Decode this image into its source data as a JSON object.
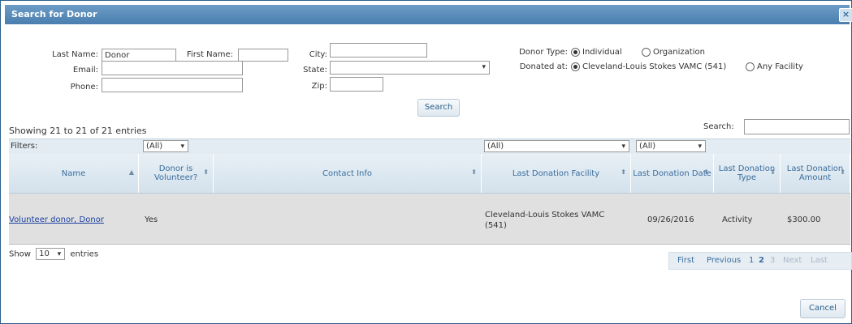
{
  "dialog": {
    "title": "Search for Donor",
    "close_glyph": "×"
  },
  "form": {
    "last_name_label": "Last Name:",
    "last_name_value": "Donor",
    "first_name_label": "First Name:",
    "first_name_value": "",
    "email_label": "Email:",
    "email_value": "",
    "phone_label": "Phone:",
    "phone_value": "",
    "city_label": "City:",
    "city_value": "",
    "state_label": "State:",
    "state_value": "",
    "zip_label": "Zip:",
    "zip_value": "",
    "donor_type_label": "Donor Type:",
    "donor_type_options": [
      "Individual",
      "Organization"
    ],
    "donor_type_selected": "Individual",
    "donated_at_label": "Donated at:",
    "donated_at_options": [
      "Cleveland-Louis Stokes VAMC (541)",
      "Any Facility"
    ],
    "donated_at_selected": "Cleveland-Louis Stokes VAMC (541)",
    "search_button": "Search"
  },
  "results": {
    "info": "Showing 21 to 21 of 21 entries",
    "search_label": "Search:",
    "search_value": "",
    "filters_label": "Filters:",
    "filter_all": "(All)",
    "columns": [
      "Name",
      "Donor is Volunteer?",
      "Contact Info",
      "Last Donation Facility",
      "Last Donation Date",
      "Last Donation Type",
      "Last Donation Amount"
    ],
    "rows": [
      {
        "name": "Volunteer donor, Donor",
        "volunteer": "Yes",
        "contact": "",
        "facility": "Cleveland-Louis Stokes VAMC (541)",
        "date": "09/26/2016",
        "type": "Activity",
        "amount": "$300.00"
      }
    ],
    "show_label_pre": "Show",
    "show_value": "10",
    "show_label_post": "entries",
    "pager": [
      "First",
      "Previous",
      "1",
      "2",
      "3",
      "Next",
      "Last"
    ]
  },
  "footer": {
    "cancel_button": "Cancel"
  },
  "colors": {
    "titlebar": "#4a7eaf",
    "header": "#d3e1ec",
    "row": "#e0e0e0",
    "link": "#1a3fa0"
  }
}
